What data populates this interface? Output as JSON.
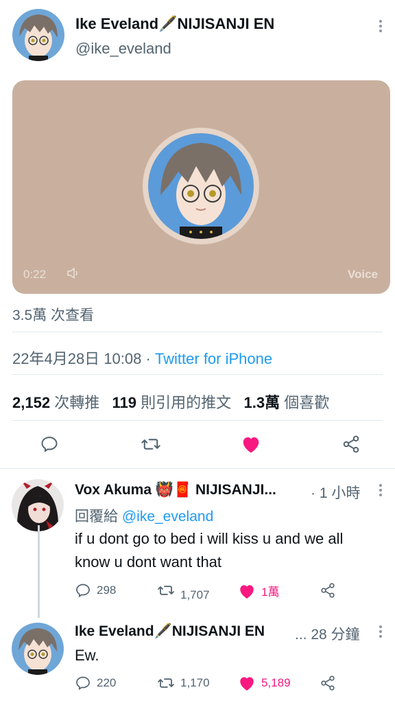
{
  "tweet": {
    "author_name": "Ike Eveland🖋️NIJISANJI EN",
    "author_handle": "@ike_eveland",
    "media": {
      "duration": "0:22",
      "badge": "Voice",
      "volume_icon": "speaker-icon"
    },
    "views": "3.5萬 次查看",
    "date": "22年4月28日 10:08",
    "separator": "·",
    "source": "Twitter for iPhone",
    "stats": {
      "retweets_count": "2,152",
      "retweets_label": "次轉推",
      "quotes_count": "119",
      "quotes_label": "則引用的推文",
      "likes_count": "1.3萬",
      "likes_label": "個喜歡"
    },
    "actions": [
      "reply-icon",
      "retweet-icon",
      "like-icon",
      "share-icon"
    ],
    "liked_color": "#f91880"
  },
  "replies": [
    {
      "author_name": "Vox Akuma 👹🧧 NIJISANJI...",
      "time": "· 1 小時",
      "reply_to_prefix": "回覆給",
      "reply_to_handle": "@ike_eveland",
      "text_line1": "if u dont go to bed i will kiss u and we all",
      "text_line2": "know u dont want that",
      "replies_count": "298",
      "retweets_count": "1,707",
      "likes_count": "1萬"
    },
    {
      "author_name": "Ike Eveland🖋️NIJISANJI EN",
      "time": "... 28 分鐘",
      "text_line1": "Ew.",
      "replies_count": "220",
      "retweets_count": "1,170",
      "likes_count": "5,189"
    }
  ]
}
